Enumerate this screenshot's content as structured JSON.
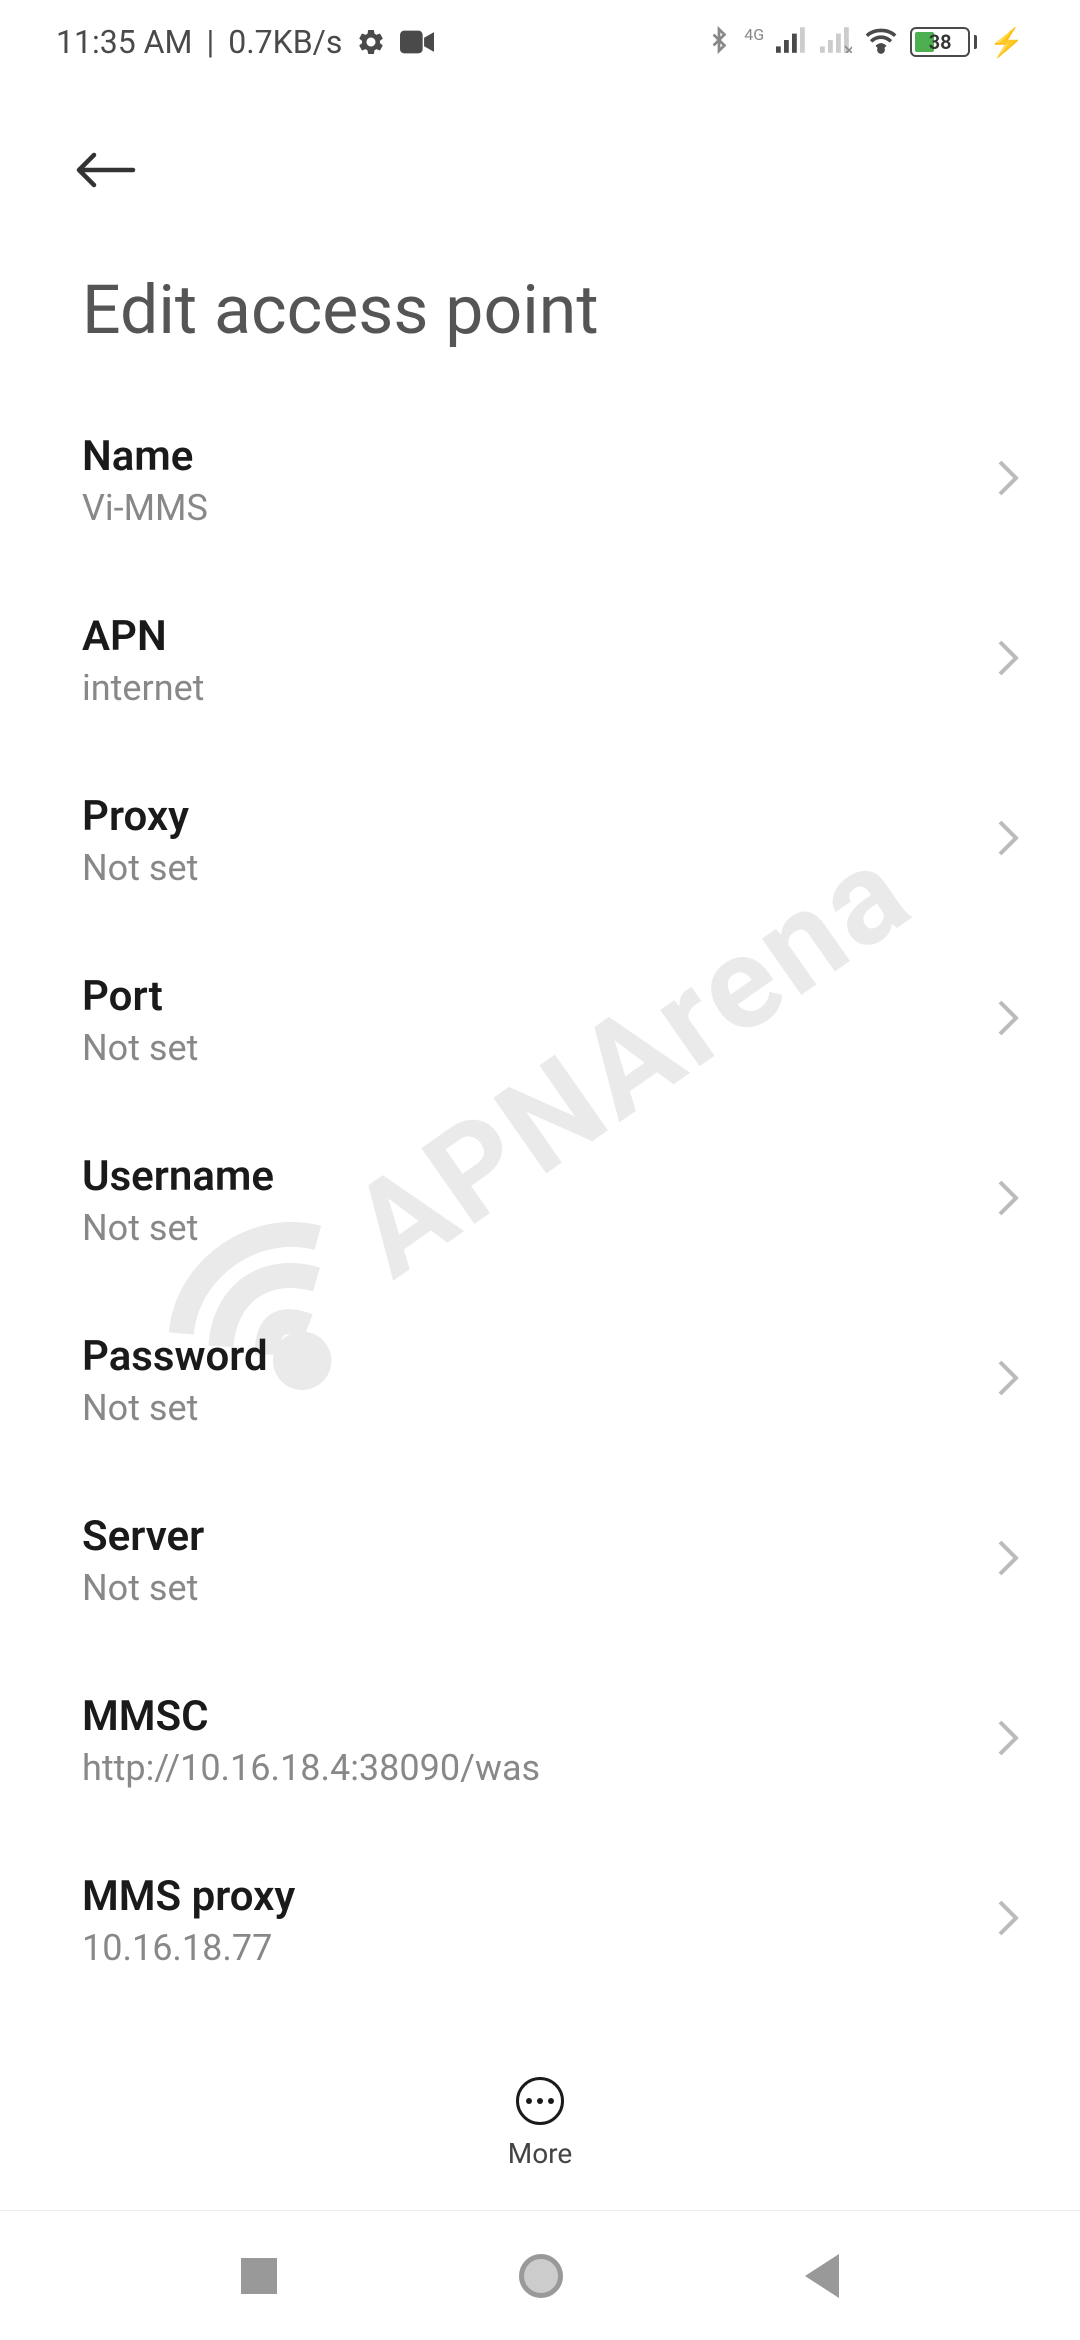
{
  "status_bar": {
    "time": "11:35 AM",
    "data_rate": "0.7KB/s",
    "separator": "|",
    "network_label": "4G",
    "battery_pct": "38"
  },
  "header": {
    "title": "Edit access point"
  },
  "settings": [
    {
      "label": "Name",
      "value": "Vi-MMS"
    },
    {
      "label": "APN",
      "value": "internet"
    },
    {
      "label": "Proxy",
      "value": "Not set"
    },
    {
      "label": "Port",
      "value": "Not set"
    },
    {
      "label": "Username",
      "value": "Not set"
    },
    {
      "label": "Password",
      "value": "Not set"
    },
    {
      "label": "Server",
      "value": "Not set"
    },
    {
      "label": "MMSC",
      "value": "http://10.16.18.4:38090/was"
    },
    {
      "label": "MMS proxy",
      "value": "10.16.18.77"
    }
  ],
  "bottom_action": {
    "more_label": "More"
  },
  "watermark": {
    "text": "APNArena"
  }
}
